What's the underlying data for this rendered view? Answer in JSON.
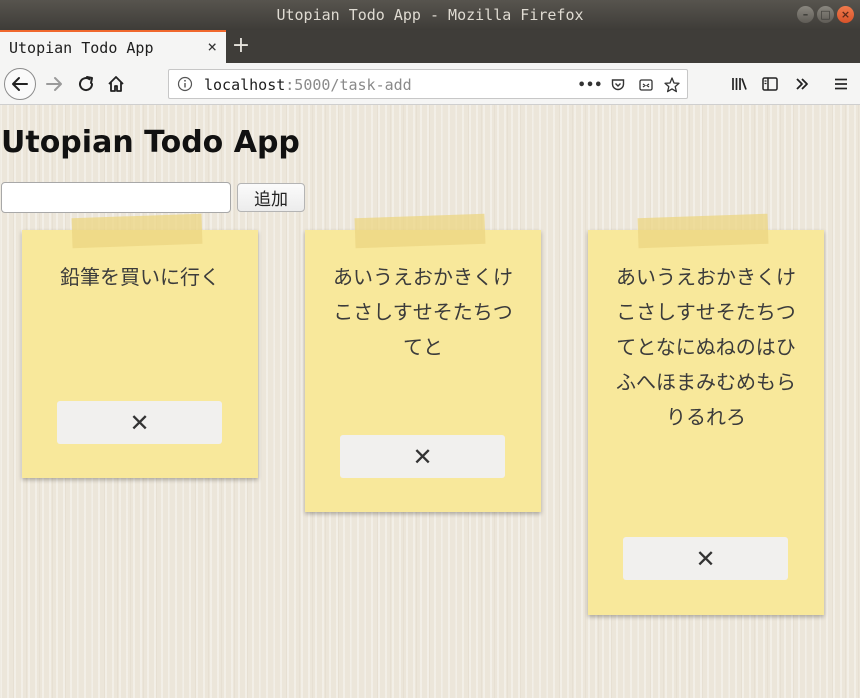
{
  "window": {
    "title": "Utopian Todo App - Mozilla Firefox",
    "controls": {
      "minimize": "–",
      "maximize": "□",
      "close": "×"
    }
  },
  "browser": {
    "tab_title": "Utopian Todo App",
    "tab_close": "×",
    "new_tab": "+",
    "url_host": "localhost",
    "url_path": ":5000/task-add",
    "page_actions": "•••"
  },
  "page": {
    "title": "Utopian Todo App",
    "input_value": "",
    "add_button": "追加"
  },
  "notes": [
    {
      "text": "鉛筆を買いに行く",
      "delete_label": "✕"
    },
    {
      "text": "あいうえおかきくけこさしすせそたちつてと",
      "delete_label": "✕"
    },
    {
      "text": "あいうえおかきくけこさしすせそたちつてとなにぬねのはひふへほまみむめもらりるれろ",
      "delete_label": "✕"
    }
  ],
  "colors": {
    "note": "#f8e89b",
    "tape": "#ecd682",
    "accent_tab": "#f0682d"
  }
}
